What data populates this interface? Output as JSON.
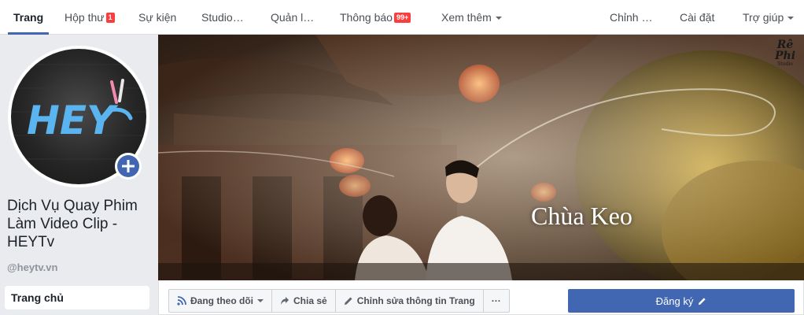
{
  "nav": {
    "home": "Trang",
    "inbox": "Hộp thư",
    "inbox_badge": "1",
    "events": "Sự kiện",
    "studio": "Studio…",
    "manage": "Quản l…",
    "notifications": "Thông báo",
    "notifications_badge": "99+",
    "more": "Xem thêm",
    "edit": "Chỉnh …",
    "settings": "Cài đặt",
    "help": "Trợ giúp"
  },
  "profile": {
    "name": "Dịch Vụ Quay Phim Làm Video Clip - HEYTv",
    "handle": "@heytv.vn",
    "logo_text": "HEY"
  },
  "left_menu": {
    "home": "Trang chủ"
  },
  "cover": {
    "title": "Chùa Keo",
    "logo_top": "Rê",
    "logo_bottom": "Phi",
    "logo_sub": "Studio"
  },
  "actions": {
    "follow": "Đang theo dõi",
    "share": "Chia sẻ",
    "edit_info": "Chỉnh sửa thông tin Trang",
    "more": "···",
    "signup": "Đăng ký"
  },
  "colors": {
    "brand_blue": "#4267b2",
    "badge_red": "#fa3e3e",
    "logo_blue": "#5ab4f0"
  }
}
